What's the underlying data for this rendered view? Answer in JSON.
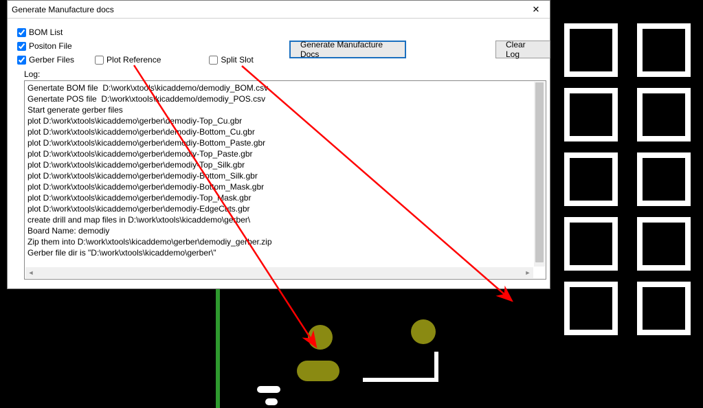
{
  "window": {
    "title": "Generate Manufacture docs",
    "close_glyph": "✕"
  },
  "options": {
    "bom": {
      "label": "BOM List",
      "checked": true
    },
    "pos": {
      "label": "Positon File",
      "checked": true
    },
    "gerber": {
      "label": "Gerber Files",
      "checked": true
    },
    "plotref": {
      "label": "Plot Reference",
      "checked": false
    },
    "splitslot": {
      "label": "Split Slot",
      "checked": false
    }
  },
  "buttons": {
    "generate": "Generate Manufacture Docs",
    "clear": "Clear Log"
  },
  "log_label": "Log:",
  "log_lines": [
    "Genertate BOM file  D:\\work\\xtools\\kicaddemo/demodiy_BOM.csv",
    "Genertate POS file  D:\\work\\xtools\\kicaddemo/demodiy_POS.csv",
    "Start generate gerber files",
    "plot D:\\work\\xtools\\kicaddemo\\gerber\\demodiy-Top_Cu.gbr",
    "plot D:\\work\\xtools\\kicaddemo\\gerber\\demodiy-Bottom_Cu.gbr",
    "plot D:\\work\\xtools\\kicaddemo\\gerber\\demodiy-Bottom_Paste.gbr",
    "plot D:\\work\\xtools\\kicaddemo\\gerber\\demodiy-Top_Paste.gbr",
    "plot D:\\work\\xtools\\kicaddemo\\gerber\\demodiy-Top_Silk.gbr",
    "plot D:\\work\\xtools\\kicaddemo\\gerber\\demodiy-Bottom_Silk.gbr",
    "plot D:\\work\\xtools\\kicaddemo\\gerber\\demodiy-Bottom_Mask.gbr",
    "plot D:\\work\\xtools\\kicaddemo\\gerber\\demodiy-Top_Mask.gbr",
    "plot D:\\work\\xtools\\kicaddemo\\gerber\\demodiy-EdgeCuts.gbr",
    "create drill and map files in D:\\work\\xtools\\kicaddemo\\gerber\\",
    "Board Name: demodiy",
    "Zip them into D:\\work\\xtools\\kicaddemo\\gerber\\demodiy_gerber.zip",
    "Gerber file dir is \"D:\\work\\xtools\\kicaddemo\\gerber\\\""
  ]
}
